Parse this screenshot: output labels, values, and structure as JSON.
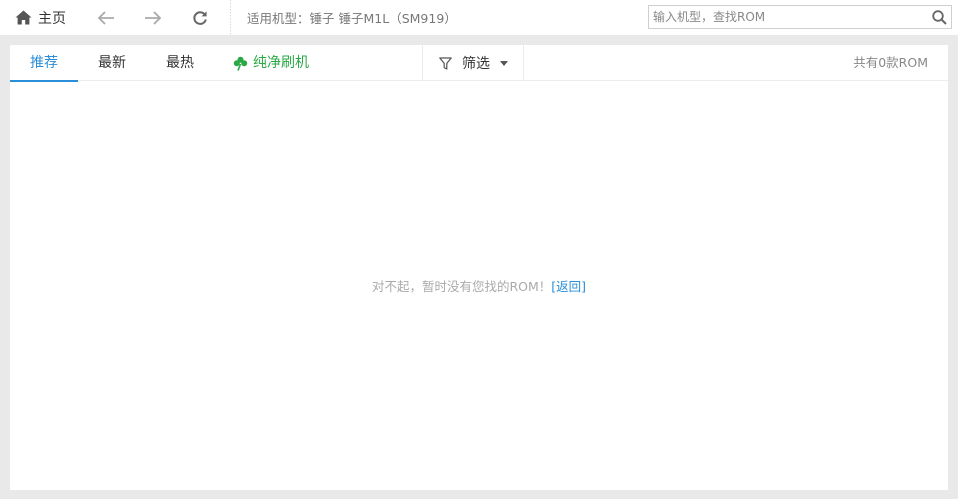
{
  "topbar": {
    "home_label": "主页",
    "model_label": "适用机型：",
    "model_value": "锤子 锤子M1L（SM919）",
    "search_placeholder": "输入机型，查找ROM"
  },
  "tabs": {
    "recommend": "推荐",
    "latest": "最新",
    "hot": "最热",
    "clean_flash": "纯净刷机"
  },
  "filter": {
    "label": "筛选"
  },
  "rom_count_text": "共有0款ROM",
  "empty": {
    "message": "对不起，暂时没有您找的ROM！",
    "back_link": "[返回]"
  },
  "colors": {
    "accent": "#2a8ed8",
    "clean_green": "#2aa845",
    "background": "#e9e9e9"
  }
}
